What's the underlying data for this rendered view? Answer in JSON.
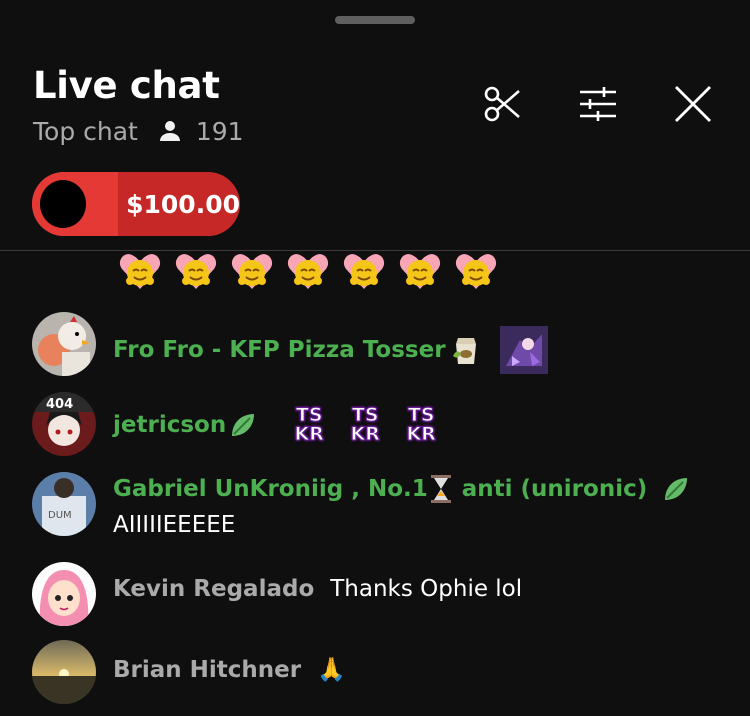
{
  "header": {
    "title": "Live chat",
    "mode": "Top chat",
    "viewer_count": "191"
  },
  "ticker": {
    "amount": "$100.00"
  },
  "messages": [
    {
      "author": "Fro Fro - KFP Pizza Tosser",
      "text": ""
    },
    {
      "author": "jetricson",
      "text": ""
    },
    {
      "author": "Gabriel UnKroniig , No.1",
      "author_suffix": "anti (unironic)",
      "text": "AIIIIIEEEEE"
    },
    {
      "author": "Kevin Regalado",
      "text": "Thanks Ophie lol"
    },
    {
      "author": "Brian Hitchner",
      "text": "🙏"
    }
  ],
  "emotes": {
    "tskr_line1": "TS",
    "tskr_line2": "KR"
  },
  "colors": {
    "member_name": "#4caf50",
    "ticker_bg": "#c62828",
    "background": "#0f0f0f"
  }
}
